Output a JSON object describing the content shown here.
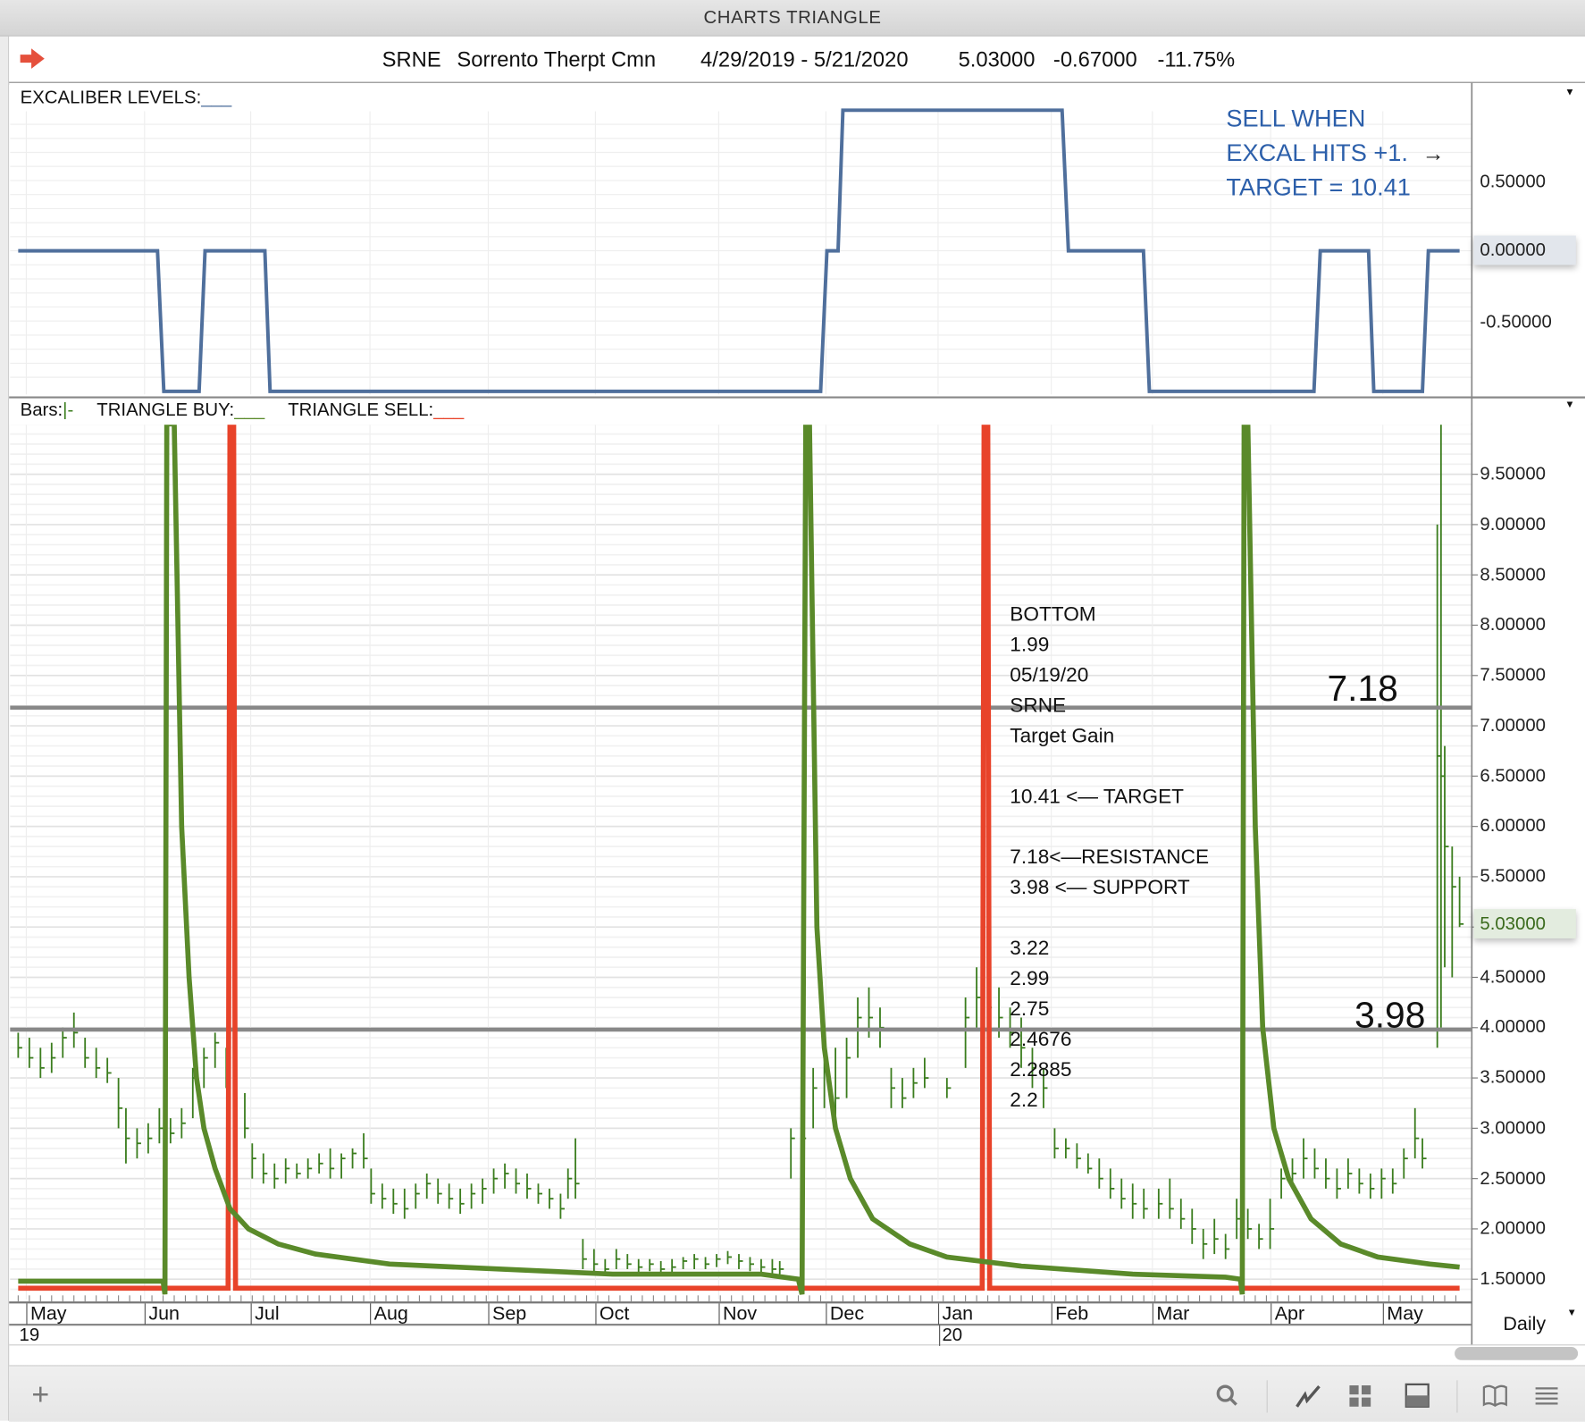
{
  "window": {
    "title": "CHARTS TRIANGLE"
  },
  "header": {
    "symbol": "SRNE",
    "name": "Sorrento Therpt Cmn",
    "date_range": "4/29/2019 - 5/21/2020",
    "last": "5.03000",
    "change": "-0.67000",
    "change_pct": "-11.75%"
  },
  "top_panel": {
    "legend_label": "EXCALIBER LEVELS:",
    "legend_swatch": "___",
    "axis_labels": [
      "0.50000",
      "-0.50000"
    ],
    "current_label": "0.00000",
    "notes": [
      "SELL WHEN",
      "EXCAL HITS +1.",
      "TARGET = 10.41"
    ],
    "arrow": "→"
  },
  "bottom_panel": {
    "bars_label": "Bars:",
    "bars_swatch": "|-",
    "buy_label": "TRIANGLE BUY:",
    "buy_swatch": "___",
    "sell_label": "TRIANGLE SELL:",
    "sell_swatch": "___",
    "current_label": "5.03000",
    "resistance_label": "7.18",
    "support_label": "3.98",
    "notes": [
      "BOTTOM",
      "1.99",
      "05/19/20",
      "SRNE",
      "Target Gain",
      "10.41 <— TARGET",
      "7.18<—RESISTANCE",
      "3.98 <— SUPPORT",
      "3.22",
      "2.99",
      "2.75",
      "2.4676",
      "2.2885",
      "2.2"
    ]
  },
  "date_axis": {
    "months": [
      "May",
      "Jun",
      "Jul",
      "Aug",
      "Sep",
      "Oct",
      "Nov",
      "Dec",
      "Jan",
      "Feb",
      "Mar",
      "Apr",
      "May"
    ],
    "years": [
      "19",
      "20"
    ],
    "interval": "Daily"
  },
  "toolbar": {
    "items": [
      "add",
      "search",
      "chart-style",
      "layout-grid",
      "panel",
      "book",
      "menu"
    ]
  },
  "colors": {
    "excaliber": "#4f6f9c",
    "buy": "#5a8a2a",
    "sell": "#e8432a",
    "bars": "#3b7d1e",
    "levels": "#888888",
    "note_blue": "#2c5faa"
  },
  "chart_data": [
    {
      "type": "line",
      "title": "EXCALIBER LEVELS",
      "x_unit": "days since 2019-04-29",
      "ylim": [
        -1,
        1
      ],
      "y_ticks": [
        0.5,
        0,
        -0.5
      ],
      "steps": [
        [
          0,
          0
        ],
        [
          37.5,
          0
        ],
        [
          39.2,
          -1
        ],
        [
          48.7,
          -1
        ],
        [
          50.3,
          0
        ],
        [
          66.4,
          0
        ],
        [
          67.8,
          -1
        ],
        [
          216,
          -1
        ],
        [
          217.7,
          0
        ],
        [
          220.7,
          0
        ],
        [
          222,
          1
        ],
        [
          281,
          1
        ],
        [
          282.7,
          0
        ],
        [
          302.9,
          0
        ],
        [
          304.5,
          -1
        ],
        [
          348.8,
          -1
        ],
        [
          350.5,
          0
        ],
        [
          363.5,
          0
        ],
        [
          364.9,
          -1
        ],
        [
          378,
          -1
        ],
        [
          379.6,
          0
        ],
        [
          388,
          0
        ]
      ]
    },
    {
      "type": "ohlc",
      "title": "SRNE Daily",
      "x_unit": "days since 2019-04-29",
      "ylim": [
        1.3,
        10.0
      ],
      "y_ticks": [
        9.5,
        9,
        8.5,
        8,
        7.5,
        7,
        6.5,
        6,
        5.5,
        4.5,
        4,
        3.5,
        3,
        2.5,
        2,
        1.5
      ],
      "month_starts": [
        2,
        33,
        63,
        94,
        125,
        155,
        186,
        216,
        247,
        278,
        307,
        338,
        368
      ],
      "horizontal_levels": [
        7.18,
        3.98
      ],
      "bars": [
        [
          0,
          3.95,
          3.7,
          3.8
        ],
        [
          3,
          3.9,
          3.6,
          3.7
        ],
        [
          6,
          3.8,
          3.5,
          3.6
        ],
        [
          9,
          3.85,
          3.55,
          3.7
        ],
        [
          12,
          4.0,
          3.7,
          3.9
        ],
        [
          15,
          4.15,
          3.8,
          3.95
        ],
        [
          18,
          3.9,
          3.6,
          3.7
        ],
        [
          21,
          3.8,
          3.5,
          3.6
        ],
        [
          24,
          3.7,
          3.45,
          3.55
        ],
        [
          27,
          3.5,
          3.0,
          3.2
        ],
        [
          29,
          3.2,
          2.65,
          2.9
        ],
        [
          32,
          3.0,
          2.7,
          2.85
        ],
        [
          35,
          3.05,
          2.75,
          2.9
        ],
        [
          38,
          3.2,
          2.85,
          3.0
        ],
        [
          41,
          3.1,
          2.85,
          2.95
        ],
        [
          44,
          3.2,
          2.9,
          3.05
        ],
        [
          47,
          3.6,
          3.1,
          3.5
        ],
        [
          50,
          3.8,
          3.4,
          3.7
        ],
        [
          53,
          3.95,
          3.6,
          3.85
        ],
        [
          56,
          3.8,
          3.4,
          3.5
        ],
        [
          58,
          3.6,
          3.2,
          3.3
        ],
        [
          61,
          3.35,
          2.9,
          3.0
        ],
        [
          63,
          2.85,
          2.5,
          2.7
        ],
        [
          66,
          2.75,
          2.45,
          2.55
        ],
        [
          69,
          2.65,
          2.4,
          2.5
        ],
        [
          72,
          2.7,
          2.45,
          2.6
        ],
        [
          75,
          2.65,
          2.5,
          2.55
        ],
        [
          78,
          2.7,
          2.5,
          2.6
        ],
        [
          81,
          2.75,
          2.55,
          2.65
        ],
        [
          84,
          2.8,
          2.5,
          2.6
        ],
        [
          87,
          2.75,
          2.5,
          2.7
        ],
        [
          90,
          2.8,
          2.6,
          2.75
        ],
        [
          93,
          2.95,
          2.6,
          2.7
        ],
        [
          95,
          2.6,
          2.25,
          2.35
        ],
        [
          98,
          2.45,
          2.2,
          2.3
        ],
        [
          101,
          2.4,
          2.15,
          2.25
        ],
        [
          104,
          2.4,
          2.1,
          2.2
        ],
        [
          107,
          2.45,
          2.2,
          2.35
        ],
        [
          110,
          2.55,
          2.3,
          2.45
        ],
        [
          113,
          2.5,
          2.25,
          2.35
        ],
        [
          116,
          2.45,
          2.2,
          2.3
        ],
        [
          119,
          2.4,
          2.15,
          2.25
        ],
        [
          122,
          2.45,
          2.2,
          2.35
        ],
        [
          125,
          2.5,
          2.25,
          2.4
        ],
        [
          128,
          2.6,
          2.35,
          2.5
        ],
        [
          131,
          2.65,
          2.4,
          2.55
        ],
        [
          134,
          2.6,
          2.35,
          2.45
        ],
        [
          137,
          2.55,
          2.3,
          2.4
        ],
        [
          140,
          2.45,
          2.25,
          2.35
        ],
        [
          143,
          2.4,
          2.2,
          2.3
        ],
        [
          146,
          2.35,
          2.1,
          2.2
        ],
        [
          148,
          2.6,
          2.3,
          2.5
        ],
        [
          150,
          2.9,
          2.3,
          2.45
        ],
        [
          152,
          1.9,
          1.6,
          1.7
        ],
        [
          155,
          1.8,
          1.55,
          1.65
        ],
        [
          158,
          1.7,
          1.55,
          1.6
        ],
        [
          161,
          1.8,
          1.6,
          1.7
        ],
        [
          164,
          1.75,
          1.6,
          1.65
        ],
        [
          167,
          1.7,
          1.55,
          1.62
        ],
        [
          170,
          1.7,
          1.58,
          1.65
        ],
        [
          173,
          1.68,
          1.55,
          1.6
        ],
        [
          176,
          1.7,
          1.55,
          1.62
        ],
        [
          179,
          1.72,
          1.6,
          1.68
        ],
        [
          182,
          1.75,
          1.6,
          1.7
        ],
        [
          185,
          1.72,
          1.6,
          1.65
        ],
        [
          188,
          1.75,
          1.62,
          1.7
        ],
        [
          191,
          1.78,
          1.65,
          1.72
        ],
        [
          194,
          1.75,
          1.6,
          1.68
        ],
        [
          197,
          1.72,
          1.58,
          1.65
        ],
        [
          200,
          1.7,
          1.55,
          1.62
        ],
        [
          203,
          1.7,
          1.55,
          1.6
        ],
        [
          205,
          1.68,
          1.55,
          1.6
        ],
        [
          208,
          3.0,
          2.5,
          2.9
        ],
        [
          211,
          3.2,
          2.7,
          2.9
        ],
        [
          214,
          3.6,
          3.0,
          3.4
        ],
        [
          217,
          3.9,
          3.2,
          3.6
        ],
        [
          220,
          3.8,
          3.0,
          3.3
        ],
        [
          223,
          3.9,
          3.3,
          3.7
        ],
        [
          226,
          4.3,
          3.7,
          4.1
        ],
        [
          229,
          4.4,
          3.9,
          4.1
        ],
        [
          232,
          4.2,
          3.8,
          4.0
        ],
        [
          235,
          3.6,
          3.2,
          3.4
        ],
        [
          238,
          3.5,
          3.2,
          3.3
        ],
        [
          241,
          3.6,
          3.3,
          3.45
        ],
        [
          244,
          3.7,
          3.4,
          3.5
        ],
        [
          250,
          3.5,
          3.3,
          3.4
        ],
        [
          255,
          4.3,
          3.6,
          4.1
        ],
        [
          258,
          4.6,
          4.0,
          4.3
        ],
        [
          261,
          4.5,
          4.0,
          4.2
        ],
        [
          264,
          4.4,
          3.9,
          4.1
        ],
        [
          267,
          4.2,
          3.8,
          3.95
        ],
        [
          270,
          4.1,
          3.6,
          3.8
        ],
        [
          273,
          3.8,
          3.4,
          3.6
        ],
        [
          276,
          3.6,
          3.2,
          3.4
        ],
        [
          279,
          3.0,
          2.7,
          2.8
        ],
        [
          282,
          2.9,
          2.7,
          2.8
        ],
        [
          285,
          2.85,
          2.6,
          2.7
        ],
        [
          288,
          2.75,
          2.55,
          2.6
        ],
        [
          291,
          2.7,
          2.4,
          2.5
        ],
        [
          294,
          2.6,
          2.3,
          2.4
        ],
        [
          297,
          2.5,
          2.2,
          2.3
        ],
        [
          300,
          2.45,
          2.1,
          2.25
        ],
        [
          303,
          2.4,
          2.1,
          2.2
        ],
        [
          307,
          2.4,
          2.1,
          2.25
        ],
        [
          310,
          2.5,
          2.1,
          2.2
        ],
        [
          313,
          2.3,
          2.0,
          2.1
        ],
        [
          316,
          2.2,
          1.85,
          2.0
        ],
        [
          319,
          2.0,
          1.7,
          1.85
        ],
        [
          322,
          2.1,
          1.75,
          1.9
        ],
        [
          325,
          1.95,
          1.7,
          1.8
        ],
        [
          328,
          2.3,
          1.9,
          2.1
        ],
        [
          331,
          2.2,
          1.9,
          2.0
        ],
        [
          334,
          2.05,
          1.8,
          1.9
        ],
        [
          337,
          2.3,
          1.8,
          2.0
        ],
        [
          340,
          2.6,
          2.3,
          2.5
        ],
        [
          343,
          2.7,
          2.4,
          2.55
        ],
        [
          346,
          2.9,
          2.5,
          2.7
        ],
        [
          349,
          2.8,
          2.5,
          2.6
        ],
        [
          352,
          2.7,
          2.4,
          2.5
        ],
        [
          355,
          2.6,
          2.3,
          2.4
        ],
        [
          358,
          2.7,
          2.4,
          2.55
        ],
        [
          361,
          2.6,
          2.35,
          2.45
        ],
        [
          364,
          2.55,
          2.3,
          2.4
        ],
        [
          367,
          2.6,
          2.3,
          2.5
        ],
        [
          370,
          2.6,
          2.35,
          2.45
        ],
        [
          373,
          2.8,
          2.5,
          2.7
        ],
        [
          376,
          3.2,
          2.7,
          2.9
        ],
        [
          378,
          2.9,
          2.6,
          2.7
        ],
        [
          382,
          9.0,
          3.8,
          6.7
        ],
        [
          383,
          10.0,
          4.0,
          6.5
        ],
        [
          384,
          6.8,
          4.6,
          5.8
        ],
        [
          386,
          5.8,
          4.5,
          5.4
        ],
        [
          388,
          5.5,
          5.0,
          5.03
        ]
      ],
      "triangle_buy": [
        [
          0,
          1.48
        ],
        [
          39,
          1.48
        ],
        [
          39.5,
          1.35
        ],
        [
          40,
          10.1
        ],
        [
          42,
          10.1
        ],
        [
          44,
          6
        ],
        [
          46,
          4.5
        ],
        [
          48,
          3.5
        ],
        [
          50,
          3.0
        ],
        [
          53,
          2.6
        ],
        [
          57,
          2.2
        ],
        [
          62,
          2.0
        ],
        [
          70,
          1.85
        ],
        [
          80,
          1.75
        ],
        [
          100,
          1.65
        ],
        [
          130,
          1.6
        ],
        [
          160,
          1.55
        ],
        [
          200,
          1.55
        ],
        [
          210,
          1.5
        ],
        [
          211,
          1.35
        ],
        [
          212,
          10.1
        ],
        [
          213,
          10.1
        ],
        [
          215,
          5
        ],
        [
          217,
          3.8
        ],
        [
          220,
          3.0
        ],
        [
          224,
          2.5
        ],
        [
          230,
          2.1
        ],
        [
          240,
          1.85
        ],
        [
          250,
          1.72
        ],
        [
          270,
          1.63
        ],
        [
          300,
          1.55
        ],
        [
          325,
          1.52
        ],
        [
          329,
          1.5
        ],
        [
          329.5,
          1.35
        ],
        [
          330,
          10.1
        ],
        [
          331,
          10.1
        ],
        [
          333,
          6
        ],
        [
          335,
          4
        ],
        [
          338,
          3.0
        ],
        [
          342,
          2.5
        ],
        [
          348,
          2.1
        ],
        [
          356,
          1.85
        ],
        [
          366,
          1.72
        ],
        [
          380,
          1.65
        ],
        [
          388,
          1.62
        ]
      ],
      "triangle_sell": [
        [
          0,
          1.41
        ],
        [
          56.5,
          1.41
        ],
        [
          57,
          10.1
        ],
        [
          58,
          10.1
        ],
        [
          58.5,
          1.41
        ],
        [
          259.5,
          1.41
        ],
        [
          260,
          10.1
        ],
        [
          261,
          10.1
        ],
        [
          261.5,
          1.41
        ],
        [
          388,
          1.41
        ]
      ]
    }
  ]
}
